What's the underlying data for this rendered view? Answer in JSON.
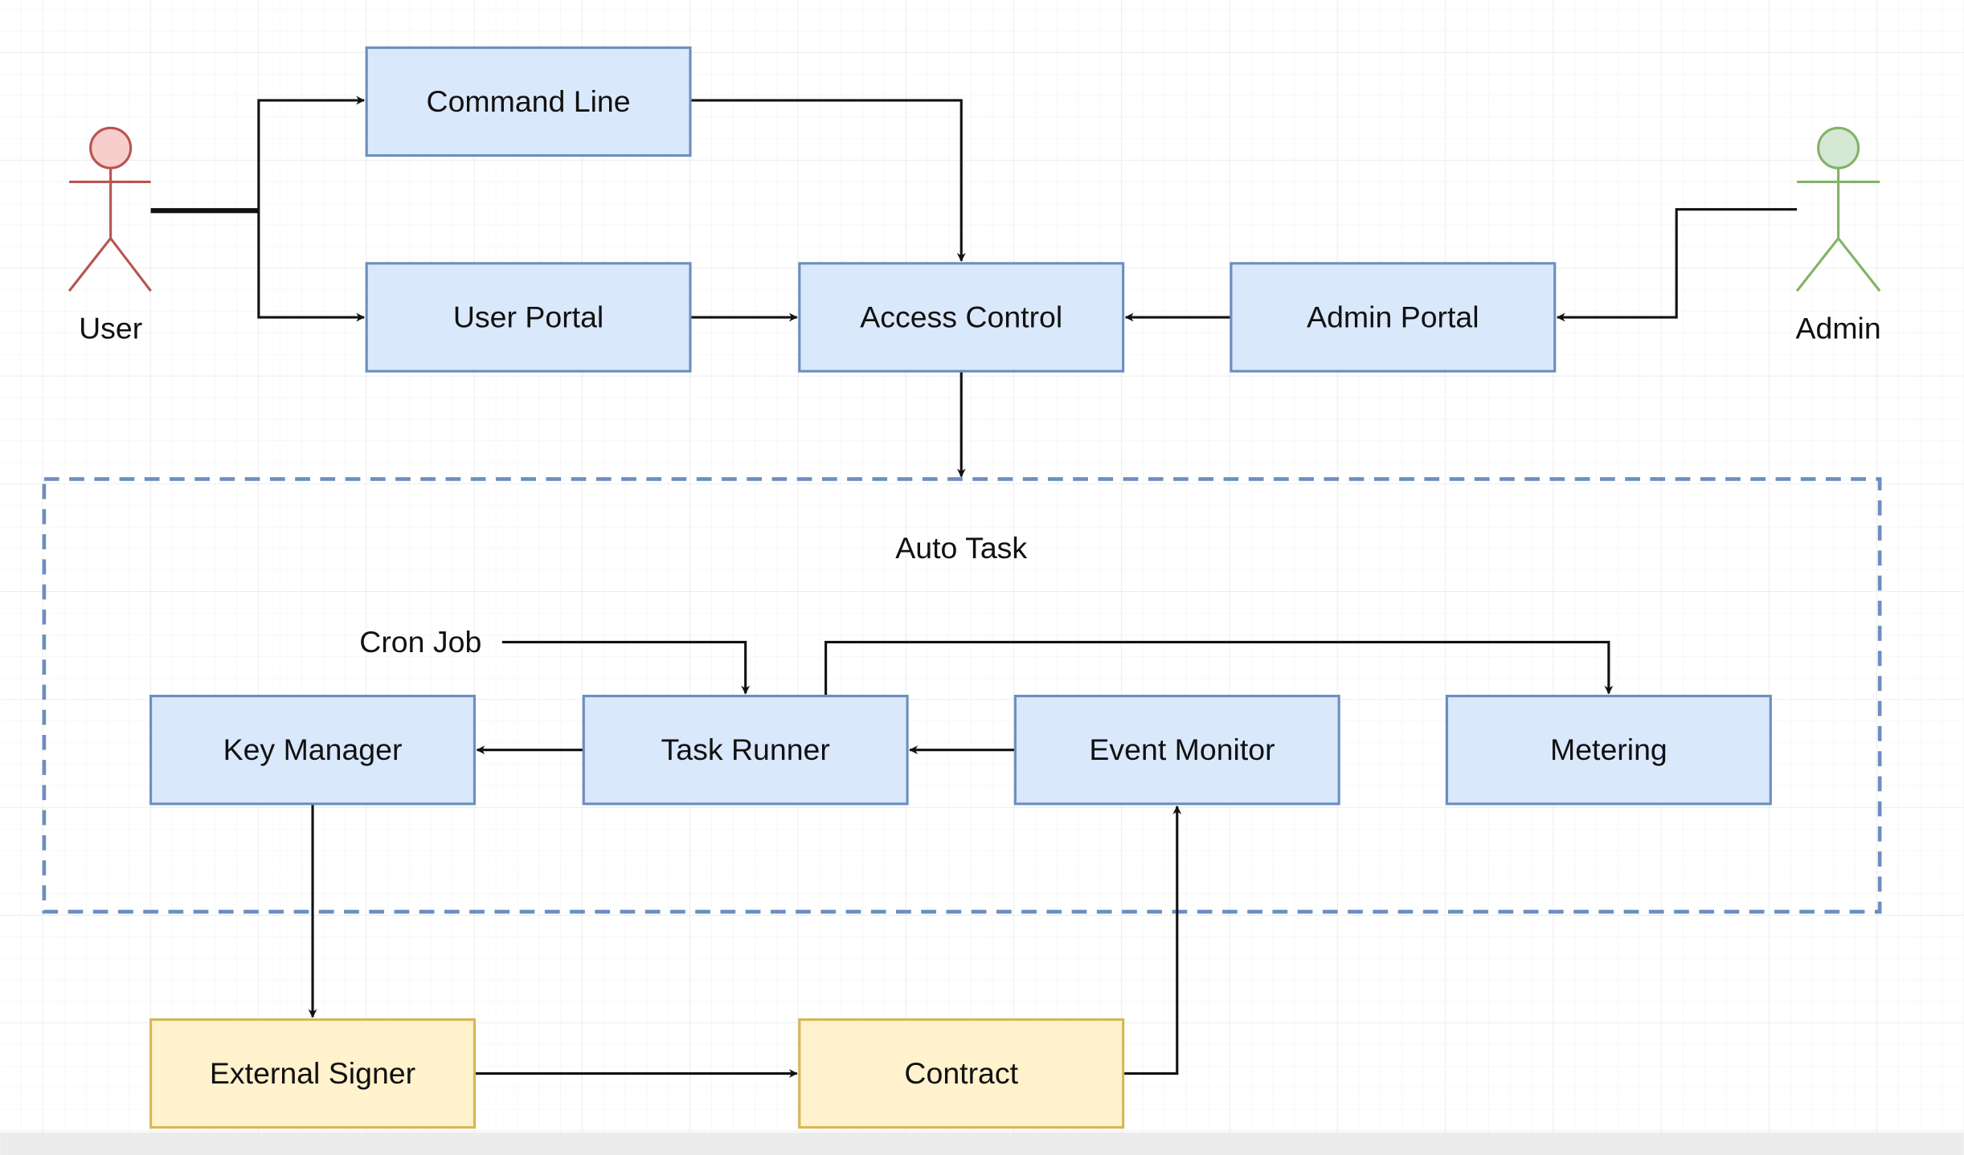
{
  "colors": {
    "process_fill": "#dae8fc",
    "process_stroke": "#6c8ebf",
    "external_fill": "#fff2cc",
    "external_stroke": "#d6b656",
    "user_actor_fill": "#f8cecc",
    "user_actor_stroke": "#b85450",
    "admin_actor_fill": "#d5e8d4",
    "admin_actor_stroke": "#82b366",
    "edge": "#111111",
    "group_border": "#6c8ebf"
  },
  "actors": {
    "user": {
      "label": "User"
    },
    "admin": {
      "label": "Admin"
    }
  },
  "nodes": {
    "command_line": "Command Line",
    "user_portal": "User Portal",
    "access_control": "Access Control",
    "admin_portal": "Admin Portal",
    "key_manager": "Key Manager",
    "task_runner": "Task Runner",
    "event_monitor": "Event Monitor",
    "metering": "Metering",
    "external_signer": "External Signer",
    "contract": "Contract"
  },
  "group": {
    "label": "Auto Task"
  },
  "labels": {
    "cron_job": "Cron Job"
  },
  "edges": [
    {
      "from": "User",
      "to": "Command Line"
    },
    {
      "from": "User",
      "to": "User Portal"
    },
    {
      "from": "Command Line",
      "to": "Access Control"
    },
    {
      "from": "User Portal",
      "to": "Access Control"
    },
    {
      "from": "Admin Portal",
      "to": "Access Control"
    },
    {
      "from": "Admin",
      "to": "Admin Portal"
    },
    {
      "from": "Access Control",
      "to": "Auto Task"
    },
    {
      "from": "Cron Job",
      "to": "Task Runner"
    },
    {
      "from": "Task Runner",
      "to": "Metering"
    },
    {
      "from": "Task Runner",
      "to": "Key Manager"
    },
    {
      "from": "Event Monitor",
      "to": "Task Runner"
    },
    {
      "from": "Key Manager",
      "to": "External Signer"
    },
    {
      "from": "External Signer",
      "to": "Contract"
    },
    {
      "from": "Contract",
      "to": "Event Monitor"
    }
  ]
}
